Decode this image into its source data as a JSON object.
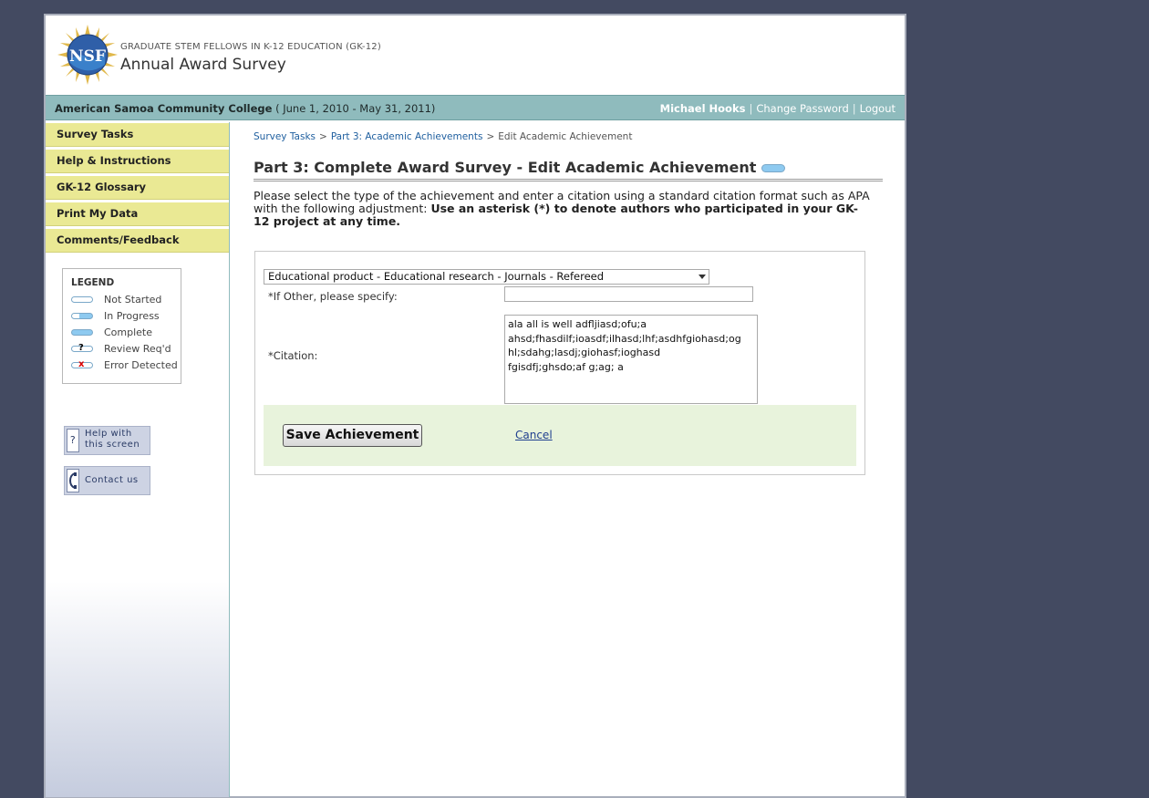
{
  "header": {
    "program": "GRADUATE STEM FELLOWS IN K-12 EDUCATION (GK-12)",
    "app_title": "Annual Award Survey",
    "logo_text": "NSF"
  },
  "infobar": {
    "institution": "American Samoa Community College",
    "period": "( June 1, 2010 - May 31, 2011)",
    "user": "Michael Hooks",
    "separator": "|",
    "change_password": "Change Password",
    "logout": "Logout"
  },
  "sidebar": {
    "nav": [
      {
        "label": "Survey Tasks"
      },
      {
        "label": "Help & Instructions"
      },
      {
        "label": "GK-12 Glossary"
      },
      {
        "label": "Print My Data"
      },
      {
        "label": "Comments/Feedback"
      }
    ],
    "legend": {
      "title": "LEGEND",
      "items": [
        {
          "label": "Not Started"
        },
        {
          "label": "In Progress"
        },
        {
          "label": "Complete"
        },
        {
          "label": "Review Req'd",
          "mark": "?"
        },
        {
          "label": "Error Detected",
          "mark": "x"
        }
      ]
    },
    "help": {
      "line1": "Help with",
      "line2": "this screen",
      "icon": "?"
    },
    "contact": {
      "label": "Contact us"
    }
  },
  "breadcrumb": {
    "items": [
      "Survey Tasks",
      "Part 3: Academic Achievements",
      "Edit Academic Achievement"
    ],
    "sep": ">"
  },
  "page": {
    "title": "Part 3: Complete Award Survey - Edit Academic Achievement",
    "instructions_plain": "Please select the type of the achievement and enter a citation using a standard citation format such as APA with the following adjustment: ",
    "instructions_bold": "Use an asterisk (*) to denote authors who participated in your GK-12 project at any time."
  },
  "form": {
    "achievement_type": "Educational product - Educational research - Journals - Refereed",
    "other_label": "*If Other, please specify:",
    "other_value": "",
    "citation_label": "*Citation:",
    "citation_value": "ala all is well adfljiasd;ofu;a\nahsd;fhasdilf;ioasdf;ilhasd;lhf;asdhfgiohasd;og\nhl;sdahg;lasdj;giohasf;ioghasd\nfgisdfj;ghsdo;af g;ag; a",
    "save_label": "Save Achievement",
    "cancel_label": "Cancel"
  },
  "colors": {
    "background": "#434a61",
    "infobar": "#8fbbbd",
    "nav": "#eae994",
    "savebar": "#e8f3dc",
    "status_complete": "#8ecaf0"
  }
}
